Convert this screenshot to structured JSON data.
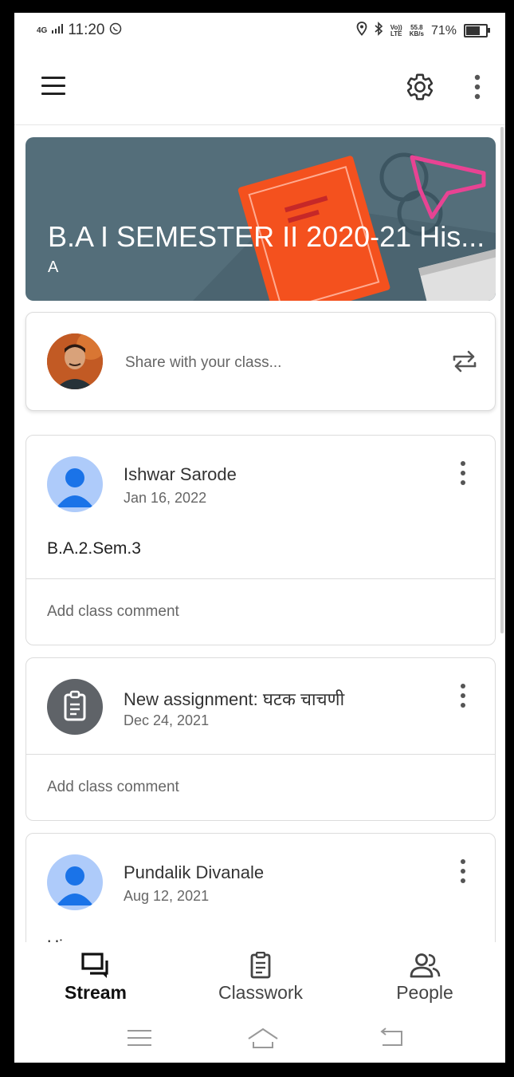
{
  "status_bar": {
    "network": "4G",
    "time": "11:20",
    "volte_top": "Vo))",
    "volte_bottom": "LTE",
    "speed_value": "55.8",
    "speed_unit": "KB/s",
    "battery_text": "71%",
    "battery_level": 0.71
  },
  "header": {
    "menu_icon": "hamburger-menu-icon",
    "settings_icon": "gear-icon",
    "more_icon": "more-vertical-icon"
  },
  "banner": {
    "title": "B.A I SEMESTER II 2020-21 His...",
    "section": "A",
    "color": "#546e7a"
  },
  "share": {
    "placeholder": "Share with your class...",
    "repost_icon": "repost-icon"
  },
  "posts": [
    {
      "author": "Ishwar Sarode",
      "date": "Jan 16, 2022",
      "body": "B.A.2.Sem.3",
      "comment": "Add class comment"
    },
    {
      "author": "New assignment: घटक चाचणी",
      "date": "Dec 24, 2021",
      "comment": "Add class comment"
    },
    {
      "author": "Pundalik Divanale",
      "date": "Aug 12, 2021",
      "body": "Hi"
    }
  ],
  "bottom_nav": [
    {
      "label": "Stream",
      "icon": "stream-icon",
      "active": true
    },
    {
      "label": "Classwork",
      "icon": "classwork-icon",
      "active": false
    },
    {
      "label": "People",
      "icon": "people-icon",
      "active": false
    }
  ],
  "colors": {
    "banner": "#546e7a",
    "avatar_person": "#aecbfa",
    "avatar_person_fg": "#1a73e8",
    "avatar_assignment": "#5f6368"
  }
}
